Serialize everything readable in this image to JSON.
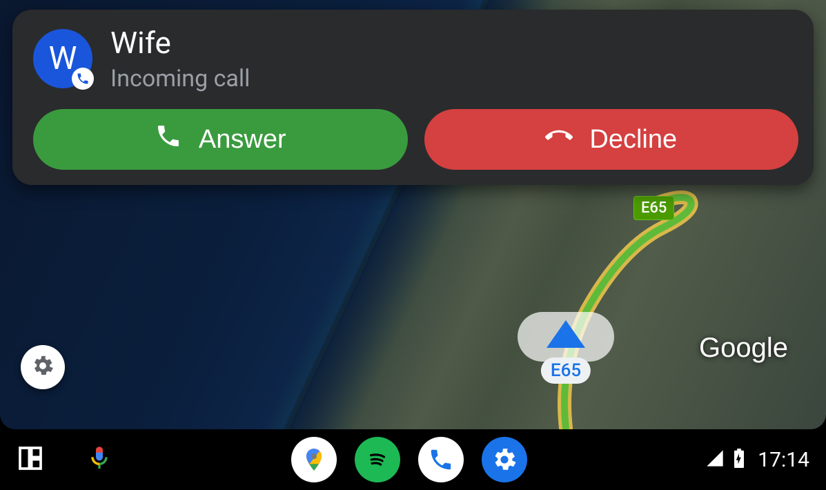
{
  "call": {
    "avatar_initial": "W",
    "caller_name": "Wife",
    "status": "Incoming call",
    "answer_label": "Answer",
    "decline_label": "Decline"
  },
  "map": {
    "road_label": "E65",
    "attribution": "Google"
  },
  "navbar": {
    "clock": "17:14"
  }
}
